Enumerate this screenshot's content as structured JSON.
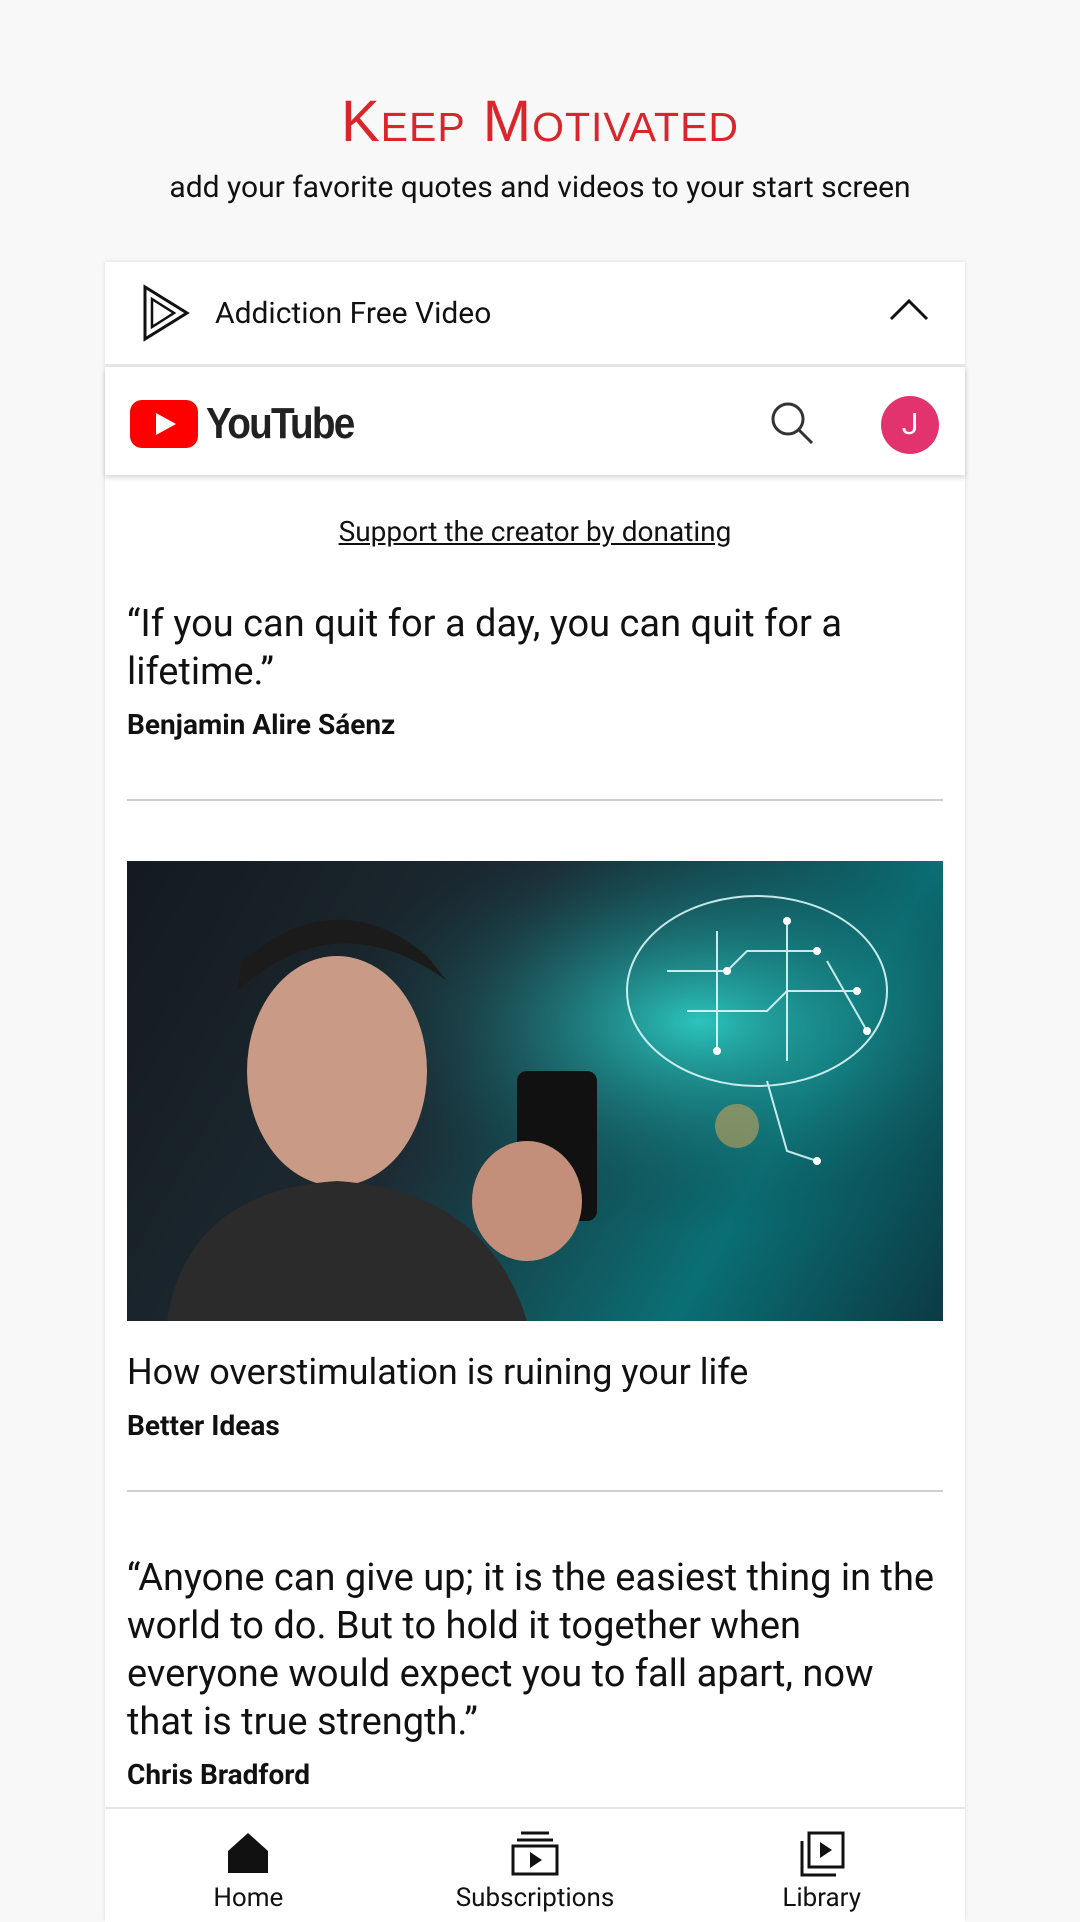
{
  "hero": {
    "title": "Keep Motivated",
    "subtitle": "add your favorite quotes and videos to your start screen"
  },
  "card": {
    "title": "Addiction Free Video"
  },
  "youtube": {
    "wordmark": "YouTube",
    "avatar_letter": "J"
  },
  "feed": {
    "donate_link": "Support the creator by donating",
    "quote1": {
      "text": "“If you can quit for a day, you can quit for a lifetime.”",
      "author": "Benjamin Alire Sáenz"
    },
    "video1": {
      "title": "How overstimulation is ruining your life",
      "channel": "Better Ideas"
    },
    "quote2": {
      "text": "“Anyone can give up; it is the easiest thing in the world to do. But to hold it together when everyone would expect you to fall apart, now that is true strength.”",
      "author": "Chris Bradford"
    }
  },
  "bottom_nav": {
    "items": [
      {
        "label": "Home",
        "icon": "home-icon"
      },
      {
        "label": "Subscriptions",
        "icon": "subscriptions-icon"
      },
      {
        "label": "Library",
        "icon": "library-icon"
      }
    ]
  },
  "colors": {
    "accent": "#d8262b",
    "youtube_red": "#ff0000",
    "avatar": "#e2336e"
  }
}
